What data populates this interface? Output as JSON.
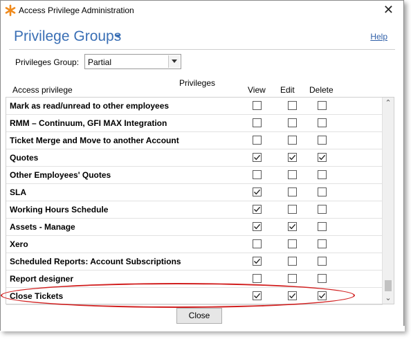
{
  "window": {
    "title": "Access Privilege Administration",
    "close_glyph": "✕"
  },
  "header": {
    "title": "Privilege Groups",
    "help": "Help"
  },
  "group": {
    "label": "Privileges Group:",
    "selected": "Partial"
  },
  "columns": {
    "privileges": "Privileges",
    "access_privilege": "Access privilege",
    "view": "View",
    "edit": "Edit",
    "delete": "Delete"
  },
  "rows": [
    {
      "label": "Mark as read/unread to other employees",
      "view": false,
      "edit": false,
      "delete": false
    },
    {
      "label": "RMM – Continuum, GFI MAX Integration",
      "view": false,
      "edit": false,
      "delete": false
    },
    {
      "label": "Ticket Merge and Move to another Account",
      "view": false,
      "edit": false,
      "delete": false
    },
    {
      "label": "Quotes",
      "view": true,
      "edit": true,
      "delete": true
    },
    {
      "label": "Other Employees' Quotes",
      "view": false,
      "edit": false,
      "delete": false
    },
    {
      "label": "SLA",
      "view": true,
      "edit": false,
      "delete": false
    },
    {
      "label": "Working Hours Schedule",
      "view": true,
      "edit": false,
      "delete": false
    },
    {
      "label": "Assets - Manage",
      "view": true,
      "edit": true,
      "delete": false
    },
    {
      "label": "Xero",
      "view": false,
      "edit": false,
      "delete": false
    },
    {
      "label": "Scheduled Reports: Account Subscriptions",
      "view": true,
      "edit": false,
      "delete": false
    },
    {
      "label": "Report designer",
      "view": false,
      "edit": false,
      "delete": false
    },
    {
      "label": "Close Tickets",
      "view": true,
      "edit": true,
      "delete": true
    }
  ],
  "scroll": {
    "up": "⌃",
    "down": "⌄"
  },
  "footer": {
    "close": "Close"
  },
  "colors": {
    "accent": "#3a6fb5",
    "highlight": "#d11f1f",
    "icon_orange": "#f08a1c"
  }
}
